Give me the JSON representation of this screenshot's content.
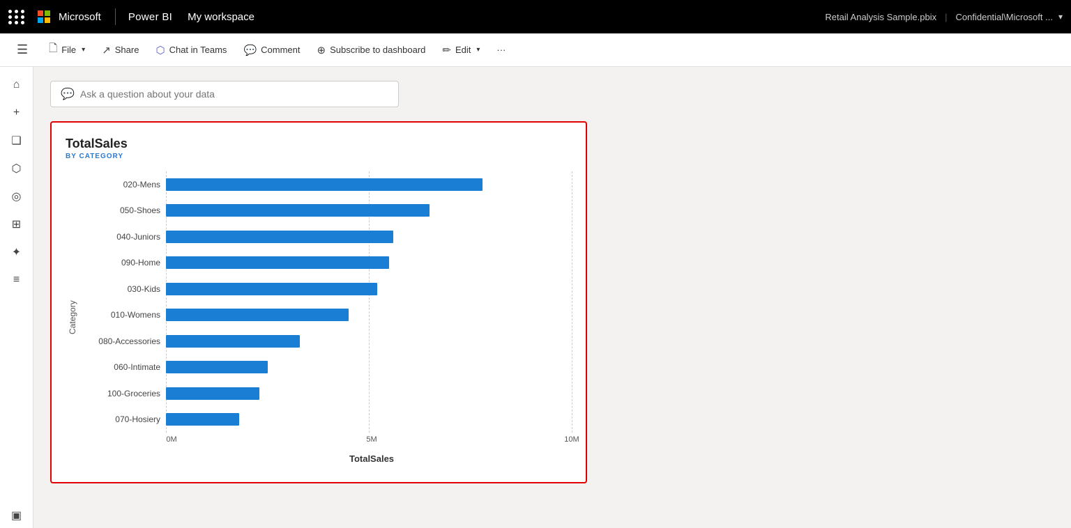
{
  "topbar": {
    "app_name": "Power BI",
    "workspace": "My workspace",
    "file_name": "Retail Analysis Sample.pbix",
    "confidential": "Confidential\\Microsoft ...",
    "chevron": "▾"
  },
  "toolbar": {
    "hamburger": "☰",
    "file_label": "File",
    "share_label": "Share",
    "chat_label": "Chat in Teams",
    "comment_label": "Comment",
    "subscribe_label": "Subscribe to dashboard",
    "edit_label": "Edit",
    "more_label": "···"
  },
  "sidebar": {
    "icons": [
      {
        "name": "home-icon",
        "glyph": "⌂"
      },
      {
        "name": "create-icon",
        "glyph": "+"
      },
      {
        "name": "browse-icon",
        "glyph": "❑"
      },
      {
        "name": "data-icon",
        "glyph": "⬡"
      },
      {
        "name": "goals-icon",
        "glyph": "◎"
      },
      {
        "name": "apps-icon",
        "glyph": "⊞"
      },
      {
        "name": "explore-icon",
        "glyph": "✦"
      },
      {
        "name": "learn-icon",
        "glyph": "≡"
      },
      {
        "name": "monitor-icon",
        "glyph": "▣"
      }
    ]
  },
  "qa_bar": {
    "placeholder": "Ask a question about your data"
  },
  "chart": {
    "title": "TotalSales",
    "subtitle": "BY CATEGORY",
    "y_axis_label": "Category",
    "x_axis_label": "TotalSales",
    "x_ticks": [
      "0M",
      "5M",
      "10M"
    ],
    "x_tick_positions": [
      0,
      50,
      100
    ],
    "max_value": 10,
    "bars": [
      {
        "label": "020-Mens",
        "value": 7.8
      },
      {
        "label": "050-Shoes",
        "value": 6.5
      },
      {
        "label": "040-Juniors",
        "value": 5.6
      },
      {
        "label": "090-Home",
        "value": 5.5
      },
      {
        "label": "030-Kids",
        "value": 5.2
      },
      {
        "label": "010-Womens",
        "value": 4.5
      },
      {
        "label": "080-Accessories",
        "value": 3.3
      },
      {
        "label": "060-Intimate",
        "value": 2.5
      },
      {
        "label": "100-Groceries",
        "value": 2.3
      },
      {
        "label": "070-Hosiery",
        "value": 1.8
      }
    ],
    "bar_color": "#1a7fd4"
  }
}
